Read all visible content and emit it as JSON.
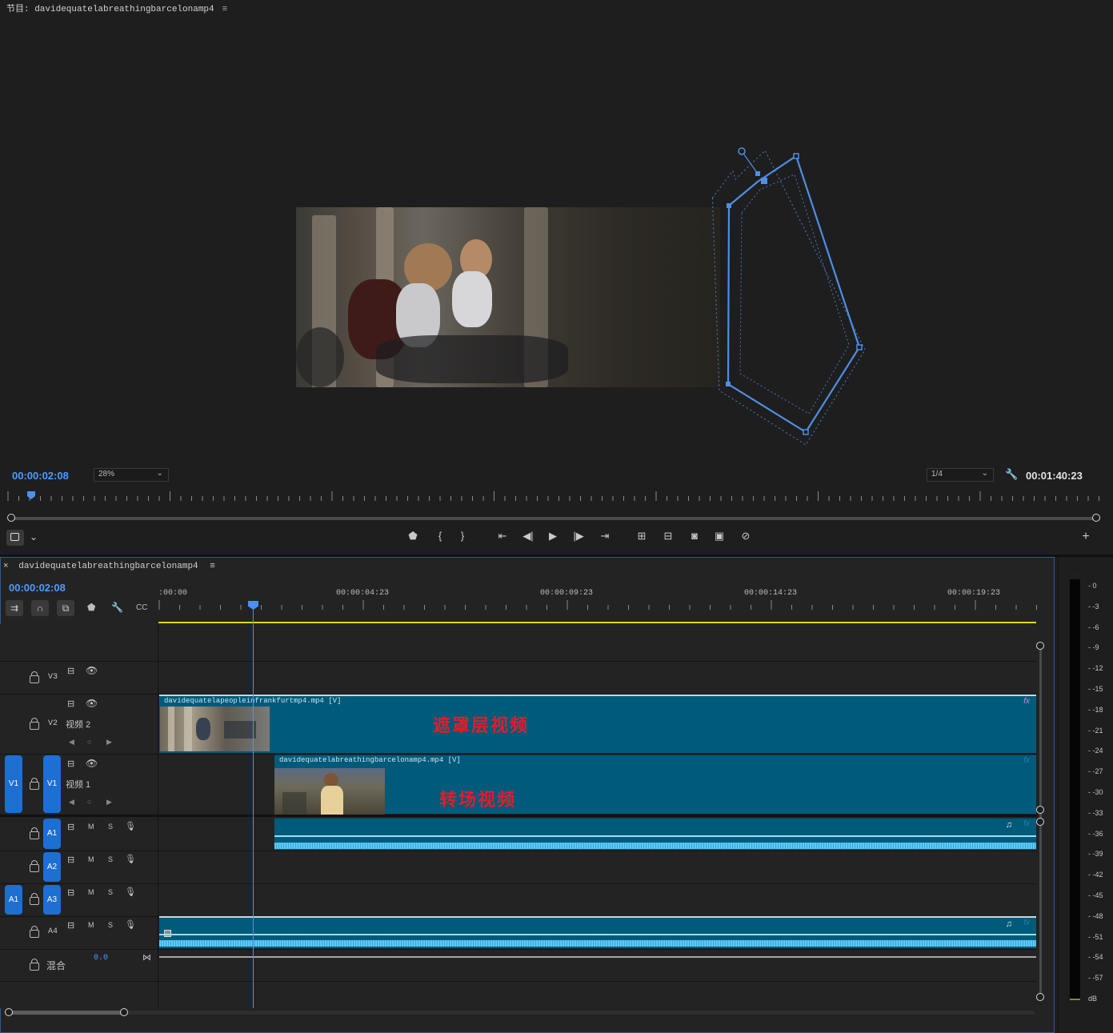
{
  "program": {
    "title": "节目: davidequatelabreathingbarcelonamp4",
    "current_time": "00:00:02:08",
    "zoom": "28%",
    "resolution": "1/4",
    "duration": "00:01:40:23",
    "progress": 0.022
  },
  "transport_icons": [
    "camera-settings-icon",
    "add-marker-icon",
    "mark-in-icon",
    "mark-out-icon",
    "go-to-in-icon",
    "step-back-icon",
    "play-icon",
    "step-forward-icon",
    "go-to-out-icon",
    "lift-icon",
    "extract-icon",
    "export-frame-icon",
    "comparison-view-icon",
    "vr-video-icon",
    "add-button-icon"
  ],
  "timeline": {
    "tab_title": "davidequatelabreathingbarcelonamp4",
    "close_symbol": "×",
    "menu_symbol": "≡",
    "current_time": "00:00:02:08",
    "ruler_labels": [
      ":00:00",
      "00:00:04:23",
      "00:00:09:23",
      "00:00:14:23",
      "00:00:19:23"
    ],
    "tracks": {
      "v3": {
        "label": "V3"
      },
      "v2": {
        "label": "V2",
        "name": "视频 2"
      },
      "v1": {
        "label": "V1",
        "name": "视频 1",
        "source": "V1"
      },
      "a1": {
        "label": "A1",
        "m": "M",
        "s": "S"
      },
      "a2": {
        "label": "A2",
        "m": "M",
        "s": "S"
      },
      "a3": {
        "label": "A3",
        "m": "M",
        "s": "S",
        "source": "A1"
      },
      "a4": {
        "label": "A4",
        "m": "M",
        "s": "S"
      },
      "mix": {
        "label": "混合",
        "value": "0.0"
      }
    },
    "clips": {
      "v2_clip": {
        "name": "davidequatelapeopleinfrankfurtmp4.mp4 [V]",
        "fx": "fx",
        "overlay": "遮罩层视频"
      },
      "v1_clip": {
        "name": "davidequatelabreathingbarcelonamp4.mp4 [V]",
        "fx": "fx",
        "overlay": "转场视频"
      },
      "a1_clip": {
        "fx": "fx"
      },
      "a4_clip": {
        "fx": "fx"
      }
    }
  },
  "meter": {
    "labels": [
      "0",
      "-3",
      "-6",
      "-9",
      "-12",
      "-15",
      "-18",
      "-21",
      "-24",
      "-27",
      "-30",
      "-33",
      "-36",
      "-39",
      "-42",
      "-45",
      "-48",
      "-51",
      "-54",
      "-57",
      "dB"
    ]
  },
  "colors": {
    "accent": "#4b9cff",
    "clip": "#005a7a",
    "mask_path": "#4f8ee6",
    "overlay_text": "#e01d2b"
  }
}
